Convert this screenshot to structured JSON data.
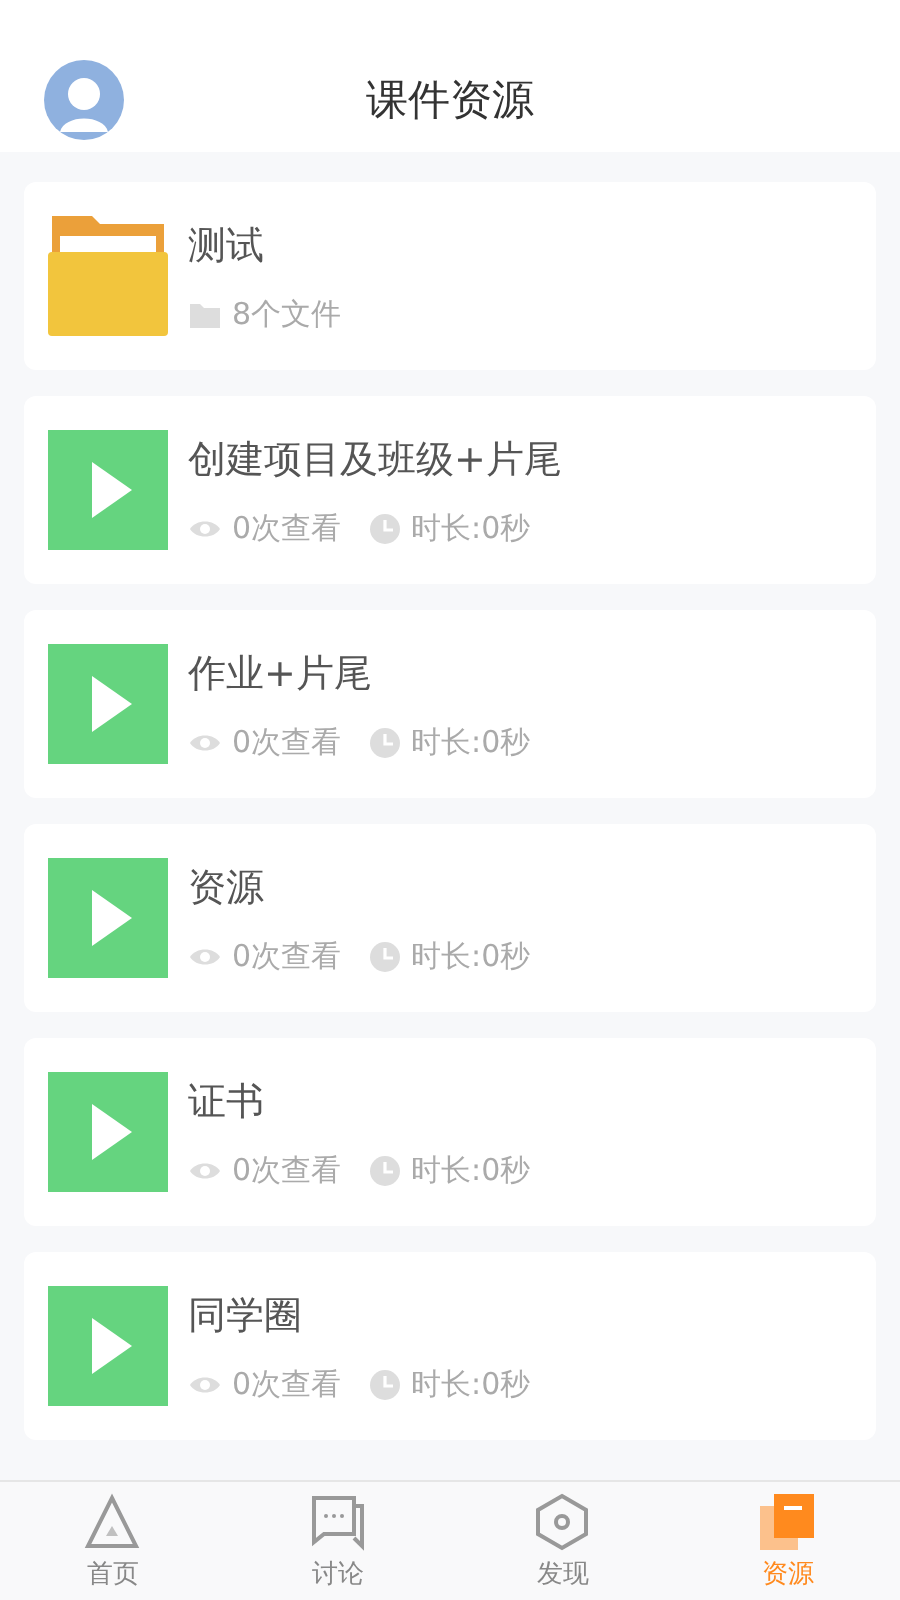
{
  "header": {
    "title": "课件资源"
  },
  "items": [
    {
      "kind": "folder",
      "title": "测试",
      "files": "8个文件"
    },
    {
      "kind": "video",
      "title": "创建项目及班级+片尾",
      "views": "0次查看",
      "duration": "时长:0秒"
    },
    {
      "kind": "video",
      "title": "作业+片尾",
      "views": "0次查看",
      "duration": "时长:0秒"
    },
    {
      "kind": "video",
      "title": "资源",
      "views": "0次查看",
      "duration": "时长:0秒"
    },
    {
      "kind": "video",
      "title": "证书",
      "views": "0次查看",
      "duration": "时长:0秒"
    },
    {
      "kind": "video",
      "title": "同学圈",
      "views": "0次查看",
      "duration": "时长:0秒"
    }
  ],
  "tabs": [
    {
      "kind": "home",
      "label": "首页",
      "selected": false
    },
    {
      "kind": "discuss",
      "label": "讨论",
      "selected": false
    },
    {
      "kind": "discover",
      "label": "发现",
      "selected": false
    },
    {
      "kind": "resources",
      "label": "资源",
      "selected": true
    }
  ]
}
